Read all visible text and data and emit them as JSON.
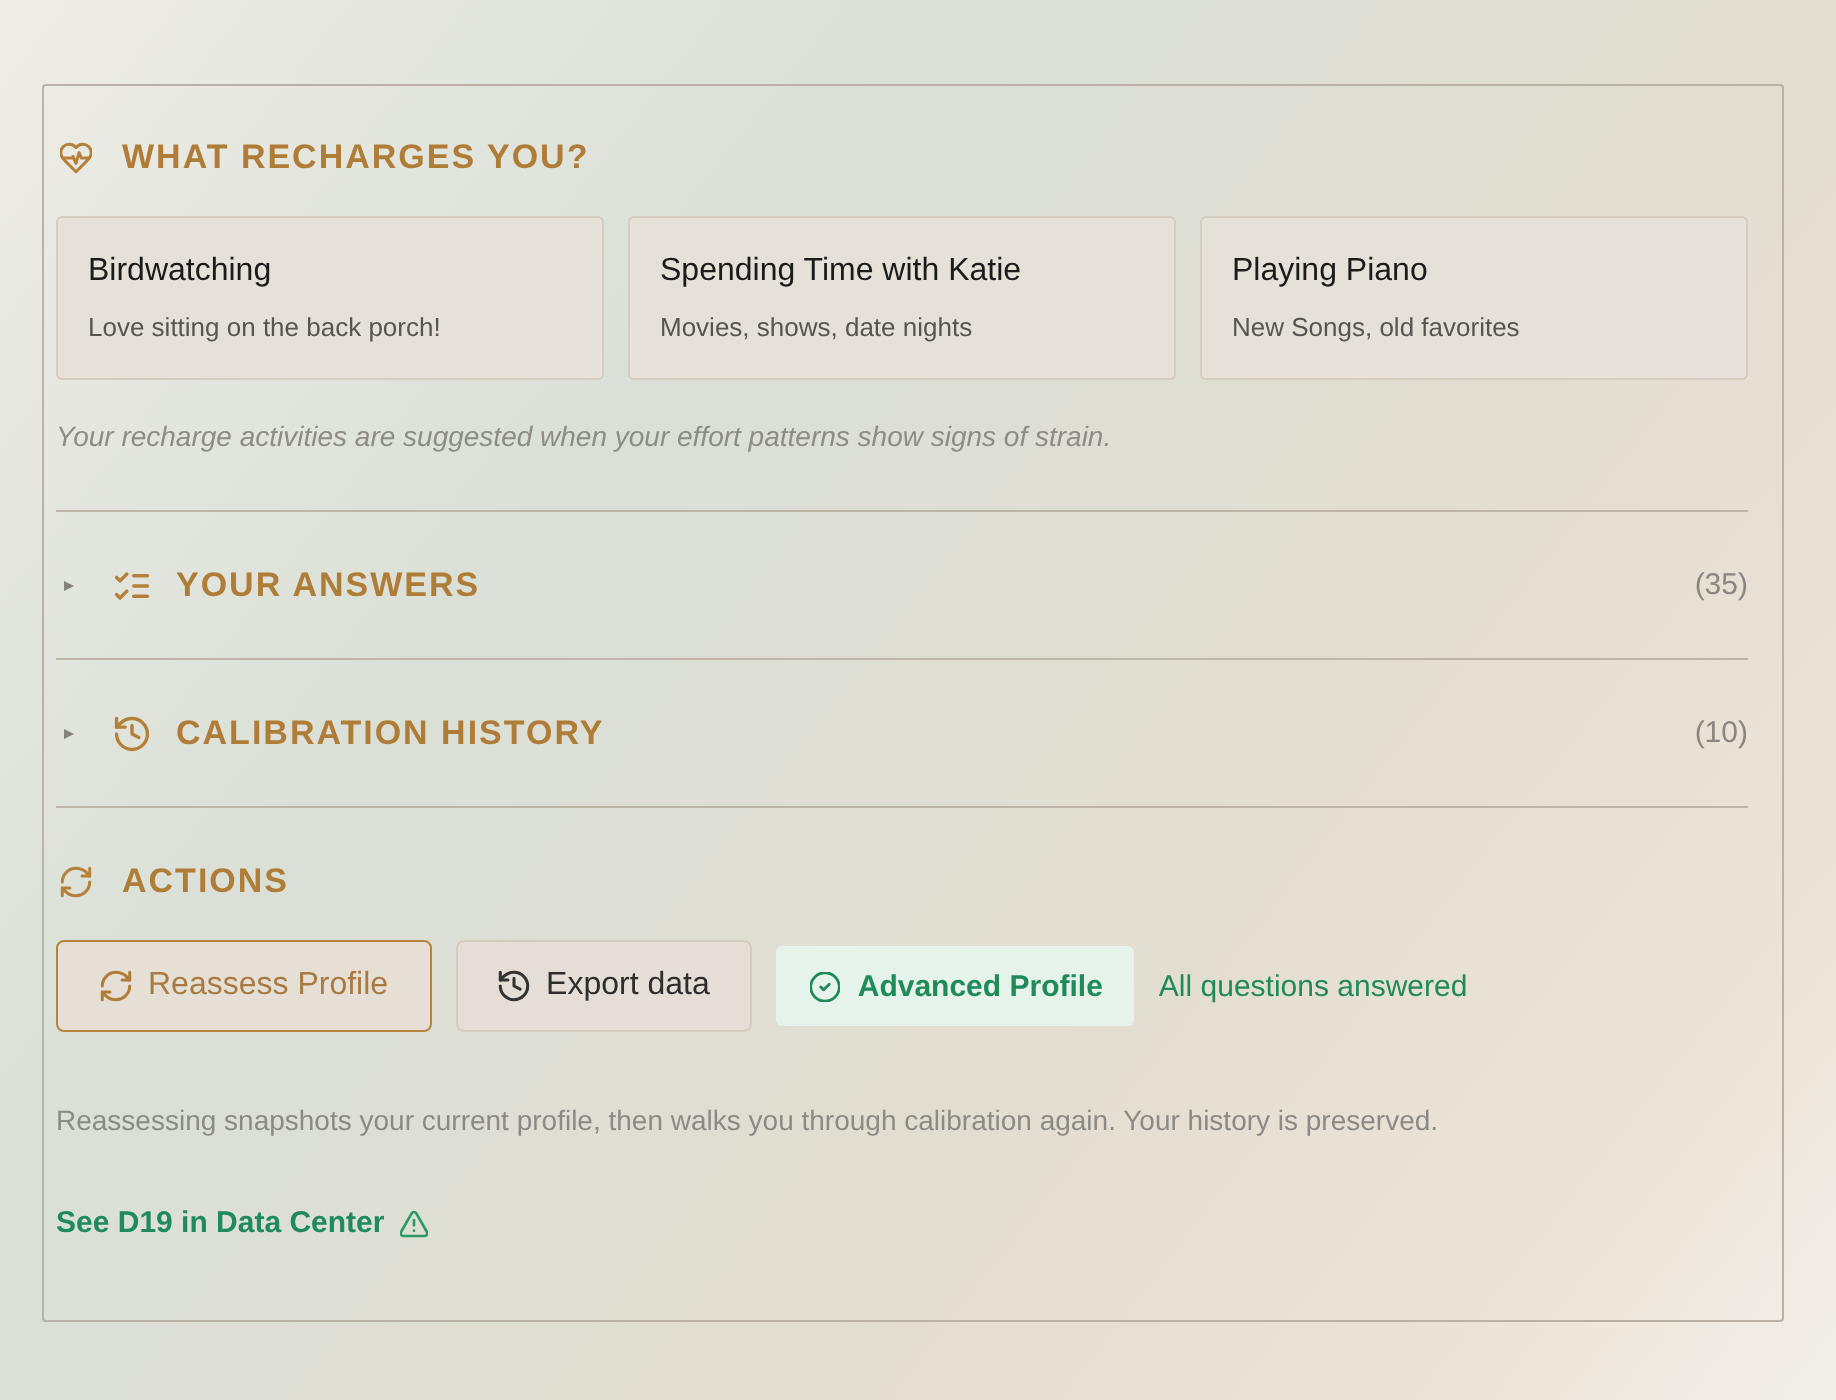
{
  "recharge": {
    "title": "WHAT RECHARGES YOU?",
    "activities": [
      {
        "name": "Birdwatching",
        "description": "Love sitting on the back porch!"
      },
      {
        "name": "Spending Time with Katie",
        "description": "Movies, shows, date nights"
      },
      {
        "name": "Playing Piano",
        "description": "New Songs, old favorites"
      }
    ],
    "note": "Your recharge activities are suggested when your effort patterns show signs of strain."
  },
  "sections": [
    {
      "kind": "answers",
      "title": "YOUR ANSWERS",
      "count": "(35)",
      "expanded": false
    },
    {
      "kind": "history",
      "title": "CALIBRATION HISTORY",
      "count": "(10)",
      "expanded": false
    }
  ],
  "actions": {
    "title": "ACTIONS",
    "buttons": [
      {
        "kind": "primary",
        "label": "Reassess Profile"
      },
      {
        "kind": "secondary",
        "label": "Export data"
      }
    ],
    "profile_badge": "Advanced Profile",
    "status_text": "All questions answered",
    "note": "Reassessing snapshots your current profile, then walks you through calibration again. Your history is preserved.",
    "link": "See D19 in Data Center"
  }
}
